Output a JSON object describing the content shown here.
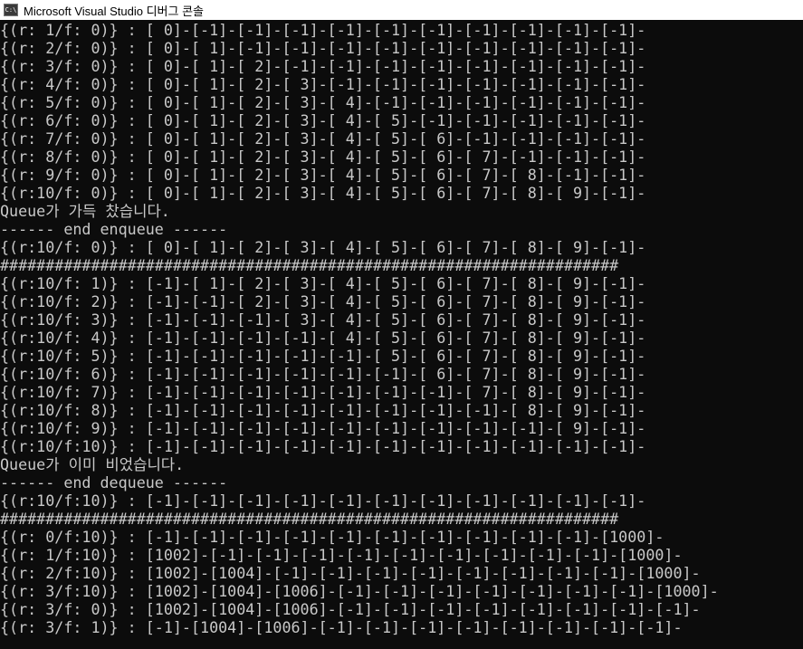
{
  "window": {
    "title": "Microsoft Visual Studio 디버그 콘솔",
    "icon": "console-app-icon"
  },
  "console": {
    "lines": [
      "{(r: 1/f: 0)} : [ 0]-[-1]-[-1]-[-1]-[-1]-[-1]-[-1]-[-1]-[-1]-[-1]-[-1]-",
      "{(r: 2/f: 0)} : [ 0]-[ 1]-[-1]-[-1]-[-1]-[-1]-[-1]-[-1]-[-1]-[-1]-[-1]-",
      "{(r: 3/f: 0)} : [ 0]-[ 1]-[ 2]-[-1]-[-1]-[-1]-[-1]-[-1]-[-1]-[-1]-[-1]-",
      "{(r: 4/f: 0)} : [ 0]-[ 1]-[ 2]-[ 3]-[-1]-[-1]-[-1]-[-1]-[-1]-[-1]-[-1]-",
      "{(r: 5/f: 0)} : [ 0]-[ 1]-[ 2]-[ 3]-[ 4]-[-1]-[-1]-[-1]-[-1]-[-1]-[-1]-",
      "{(r: 6/f: 0)} : [ 0]-[ 1]-[ 2]-[ 3]-[ 4]-[ 5]-[-1]-[-1]-[-1]-[-1]-[-1]-",
      "{(r: 7/f: 0)} : [ 0]-[ 1]-[ 2]-[ 3]-[ 4]-[ 5]-[ 6]-[-1]-[-1]-[-1]-[-1]-",
      "{(r: 8/f: 0)} : [ 0]-[ 1]-[ 2]-[ 3]-[ 4]-[ 5]-[ 6]-[ 7]-[-1]-[-1]-[-1]-",
      "{(r: 9/f: 0)} : [ 0]-[ 1]-[ 2]-[ 3]-[ 4]-[ 5]-[ 6]-[ 7]-[ 8]-[-1]-[-1]-",
      "{(r:10/f: 0)} : [ 0]-[ 1]-[ 2]-[ 3]-[ 4]-[ 5]-[ 6]-[ 7]-[ 8]-[ 9]-[-1]-",
      "Queue가 가득 찼습니다.",
      "------ end enqueue ------",
      "{(r:10/f: 0)} : [ 0]-[ 1]-[ 2]-[ 3]-[ 4]-[ 5]-[ 6]-[ 7]-[ 8]-[ 9]-[-1]-",
      "####################################################################",
      "{(r:10/f: 1)} : [-1]-[ 1]-[ 2]-[ 3]-[ 4]-[ 5]-[ 6]-[ 7]-[ 8]-[ 9]-[-1]-",
      "{(r:10/f: 2)} : [-1]-[-1]-[ 2]-[ 3]-[ 4]-[ 5]-[ 6]-[ 7]-[ 8]-[ 9]-[-1]-",
      "{(r:10/f: 3)} : [-1]-[-1]-[-1]-[ 3]-[ 4]-[ 5]-[ 6]-[ 7]-[ 8]-[ 9]-[-1]-",
      "{(r:10/f: 4)} : [-1]-[-1]-[-1]-[-1]-[ 4]-[ 5]-[ 6]-[ 7]-[ 8]-[ 9]-[-1]-",
      "{(r:10/f: 5)} : [-1]-[-1]-[-1]-[-1]-[-1]-[ 5]-[ 6]-[ 7]-[ 8]-[ 9]-[-1]-",
      "{(r:10/f: 6)} : [-1]-[-1]-[-1]-[-1]-[-1]-[-1]-[ 6]-[ 7]-[ 8]-[ 9]-[-1]-",
      "{(r:10/f: 7)} : [-1]-[-1]-[-1]-[-1]-[-1]-[-1]-[-1]-[ 7]-[ 8]-[ 9]-[-1]-",
      "{(r:10/f: 8)} : [-1]-[-1]-[-1]-[-1]-[-1]-[-1]-[-1]-[-1]-[ 8]-[ 9]-[-1]-",
      "{(r:10/f: 9)} : [-1]-[-1]-[-1]-[-1]-[-1]-[-1]-[-1]-[-1]-[-1]-[ 9]-[-1]-",
      "{(r:10/f:10)} : [-1]-[-1]-[-1]-[-1]-[-1]-[-1]-[-1]-[-1]-[-1]-[-1]-[-1]-",
      "Queue가 이미 비었습니다.",
      "------ end dequeue ------",
      "{(r:10/f:10)} : [-1]-[-1]-[-1]-[-1]-[-1]-[-1]-[-1]-[-1]-[-1]-[-1]-[-1]-",
      "####################################################################",
      "{(r: 0/f:10)} : [-1]-[-1]-[-1]-[-1]-[-1]-[-1]-[-1]-[-1]-[-1]-[-1]-[1000]-",
      "{(r: 1/f:10)} : [1002]-[-1]-[-1]-[-1]-[-1]-[-1]-[-1]-[-1]-[-1]-[-1]-[1000]-",
      "{(r: 2/f:10)} : [1002]-[1004]-[-1]-[-1]-[-1]-[-1]-[-1]-[-1]-[-1]-[-1]-[1000]-",
      "{(r: 3/f:10)} : [1002]-[1004]-[1006]-[-1]-[-1]-[-1]-[-1]-[-1]-[-1]-[-1]-[1000]-",
      "{(r: 3/f: 0)} : [1002]-[1004]-[1006]-[-1]-[-1]-[-1]-[-1]-[-1]-[-1]-[-1]-[-1]-",
      "{(r: 3/f: 1)} : [-1]-[1004]-[1006]-[-1]-[-1]-[-1]-[-1]-[-1]-[-1]-[-1]-[-1]-"
    ]
  }
}
